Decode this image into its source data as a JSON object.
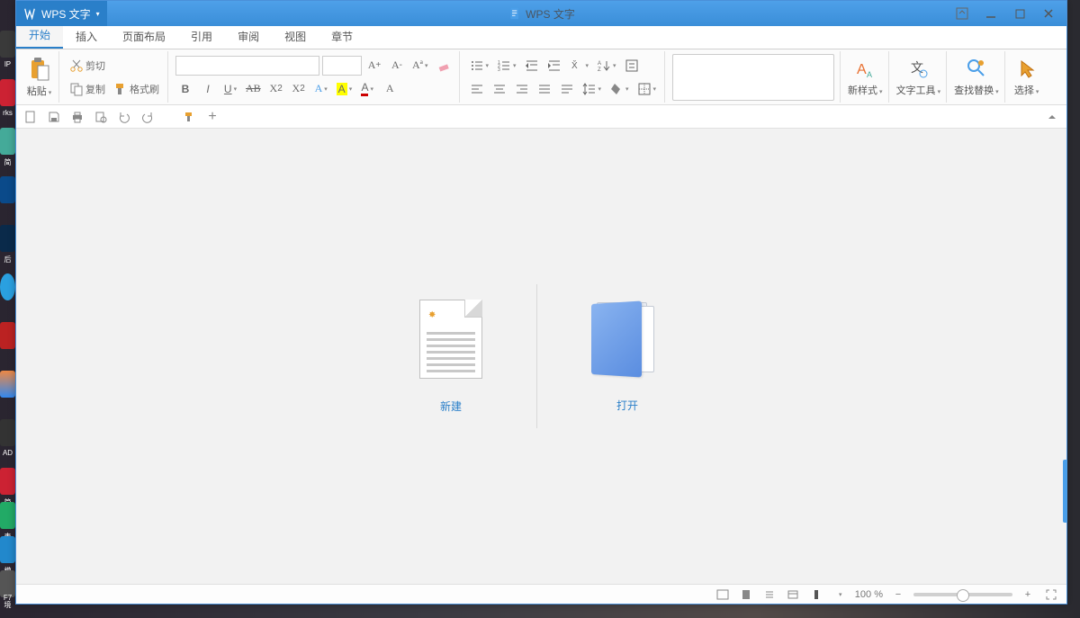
{
  "app_tab": {
    "label": "WPS 文字"
  },
  "window_title": "WPS 文字",
  "menu_tabs": [
    "开始",
    "插入",
    "页面布局",
    "引用",
    "审阅",
    "视图",
    "章节"
  ],
  "active_tab_index": 0,
  "clipboard": {
    "paste": "粘贴",
    "cut": "剪切",
    "copy": "复制",
    "format_painter": "格式刷"
  },
  "right_groups": {
    "new_style": "新样式",
    "text_tools": "文字工具",
    "find_replace": "查找替换",
    "select": "选择"
  },
  "start_actions": {
    "new": "新建",
    "open": "打开"
  },
  "status": {
    "zoom": "100 %"
  },
  "desktop_icons": [
    "lP",
    "rks",
    "简",
    "后",
    "AD",
    "简",
    "表",
    "模",
    "境",
    "F7"
  ]
}
